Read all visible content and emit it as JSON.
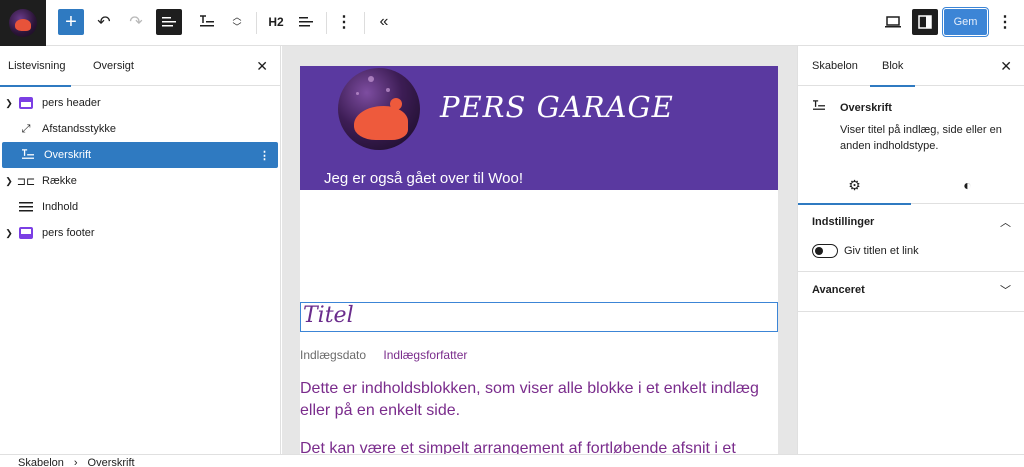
{
  "toolbar": {
    "h2_label": "H2",
    "save_label": "Gem",
    "icons": {
      "add": "plus-icon",
      "undo": "undo-icon",
      "redo": "redo-icon",
      "list_view": "list-view-icon",
      "block_type": "heading-icon",
      "mover": "chevron-up-down-icon",
      "align": "align-left-icon",
      "more": "more-vertical-icon",
      "collapse": "chevron-double-left-icon",
      "preview": "desktop-icon",
      "settings": "sidebar-icon",
      "options": "more-vertical-icon"
    },
    "colors": {
      "accent": "#2f7ac1",
      "save_bg": "#3c85d6"
    }
  },
  "left_panel": {
    "tabs": [
      "Listevisning",
      "Oversigt"
    ],
    "active_tab": "Listevisning",
    "items": [
      {
        "label": "pers header",
        "icon": "template-part-header-icon",
        "expandable": true,
        "selected": false
      },
      {
        "label": "Afstandsstykke",
        "icon": "resize-arrow-icon",
        "expandable": false,
        "selected": false
      },
      {
        "label": "Overskrift",
        "icon": "heading-icon",
        "expandable": false,
        "selected": true
      },
      {
        "label": "Række",
        "icon": "row-icon",
        "expandable": true,
        "selected": false
      },
      {
        "label": "Indhold",
        "icon": "content-lines-icon",
        "expandable": false,
        "selected": false
      },
      {
        "label": "pers footer",
        "icon": "template-part-footer-icon",
        "expandable": true,
        "selected": false
      }
    ]
  },
  "canvas": {
    "site_title": "PERS GARAGE",
    "tagline": "Jeg er også gået over til Woo!",
    "post_title": "Titel",
    "post_date": "Indlægsdato",
    "post_author": "Indlægsforfatter",
    "content_p1": "Dette er indholdsblokken, som viser alle blokke i et enkelt indlæg eller på en enkelt side.",
    "content_p2": "Det kan være et simpelt arrangement af fortløbende afsnit i et",
    "colors": {
      "header_bg": "#5a39a0",
      "text_accent": "#7a2c8c"
    }
  },
  "right_panel": {
    "tabs": [
      "Skabelon",
      "Blok"
    ],
    "active_tab": "Blok",
    "block_name": "Overskrift",
    "block_description": "Viser titel på indlæg, side eller en anden indholdstype.",
    "subtabs": [
      "settings-gear-icon",
      "styles-contrast-icon"
    ],
    "sections": [
      {
        "title": "Indstillinger",
        "expanded": true
      },
      {
        "title": "Avanceret",
        "expanded": false
      }
    ],
    "toggle_label": "Giv titlen et link",
    "toggle_on": false
  },
  "footer": {
    "breadcrumbs": [
      "Skabelon",
      "Overskrift"
    ]
  }
}
